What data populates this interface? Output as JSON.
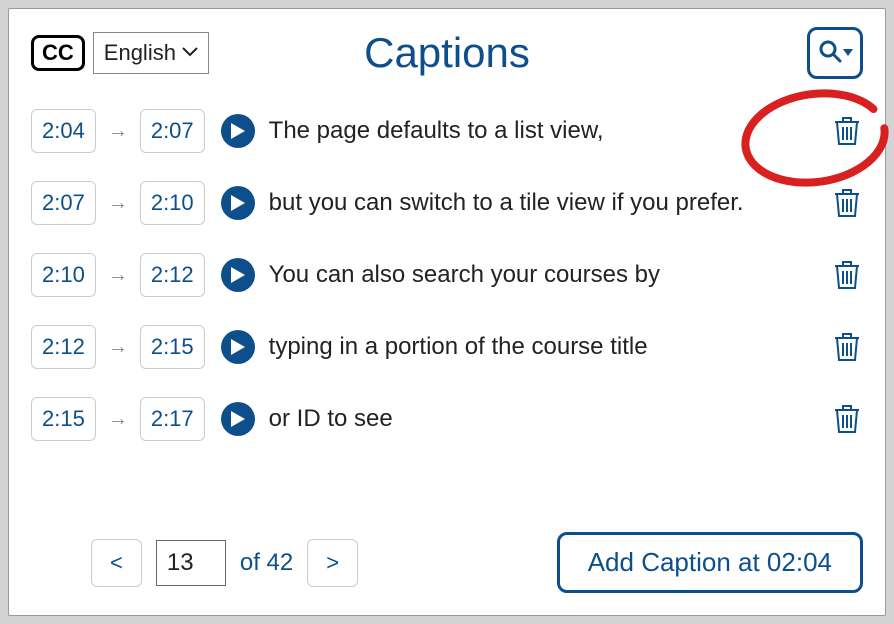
{
  "header": {
    "cc_label": "CC",
    "language": "English",
    "title": "Captions"
  },
  "captions": [
    {
      "start": "2:04",
      "end": "2:07",
      "text": "The page defaults to a list view,"
    },
    {
      "start": "2:07",
      "end": "2:10",
      "text": "but you can switch to a tile view if you prefer."
    },
    {
      "start": "2:10",
      "end": "2:12",
      "text": "You can also search your courses by"
    },
    {
      "start": "2:12",
      "end": "2:15",
      "text": "typing in a portion of the course title"
    },
    {
      "start": "2:15",
      "end": "2:17",
      "text": "or ID to see"
    }
  ],
  "pagination": {
    "prev_label": "<",
    "next_label": ">",
    "current": "13",
    "of_label": "of 42"
  },
  "add_caption_label": "Add Caption at 02:04"
}
